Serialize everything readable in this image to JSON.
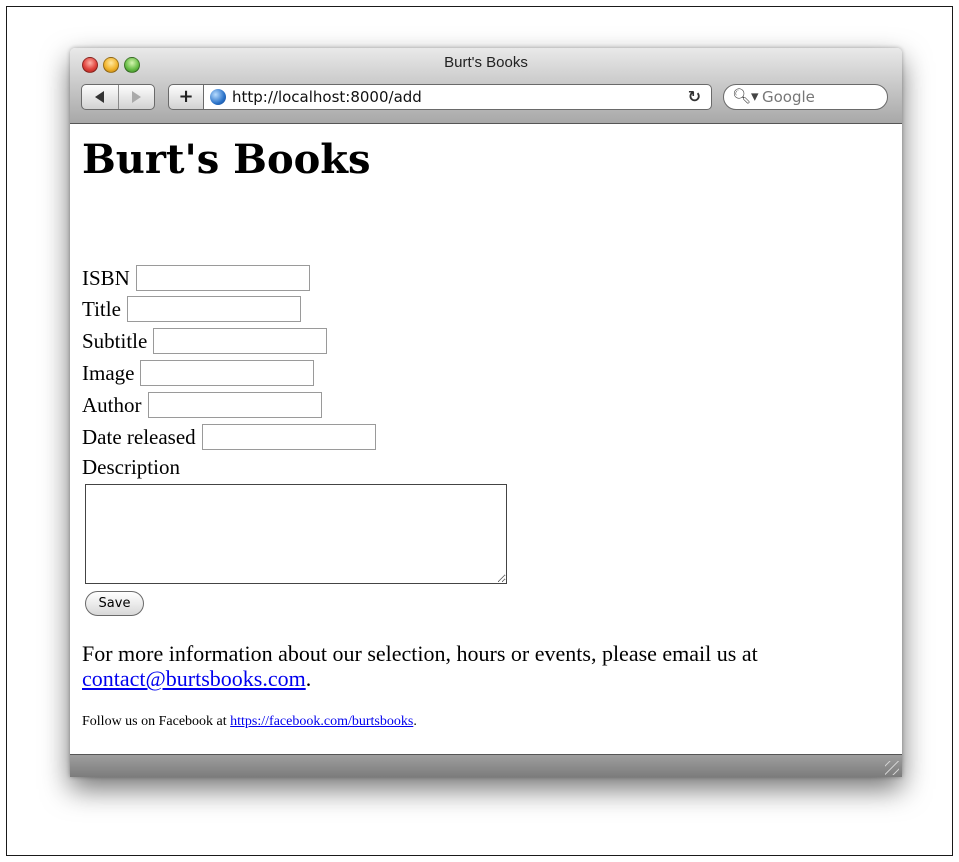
{
  "window": {
    "title": "Burt's Books"
  },
  "toolbar": {
    "back_icon": "back-arrow",
    "forward_icon": "forward-arrow",
    "add_label": "+",
    "url": "http://localhost:8000/add",
    "reload_glyph": "c",
    "search_placeholder": "Google"
  },
  "page": {
    "heading": "Burt's Books",
    "form": {
      "fields": [
        {
          "label": "ISBN",
          "value": ""
        },
        {
          "label": "Title",
          "value": ""
        },
        {
          "label": "Subtitle",
          "value": ""
        },
        {
          "label": "Image",
          "value": ""
        },
        {
          "label": "Author",
          "value": ""
        },
        {
          "label": "Date released",
          "value": ""
        }
      ],
      "description_label": "Description",
      "description_value": "",
      "save_label": "Save"
    },
    "info_text": "For more information about our selection, hours or events, please email us at",
    "info_email": "contact@burtsbooks.com",
    "info_end": ".",
    "facebook_text": "Follow us on Facebook at",
    "facebook_link": "https://facebook.com/burtsbooks",
    "facebook_end": "."
  }
}
